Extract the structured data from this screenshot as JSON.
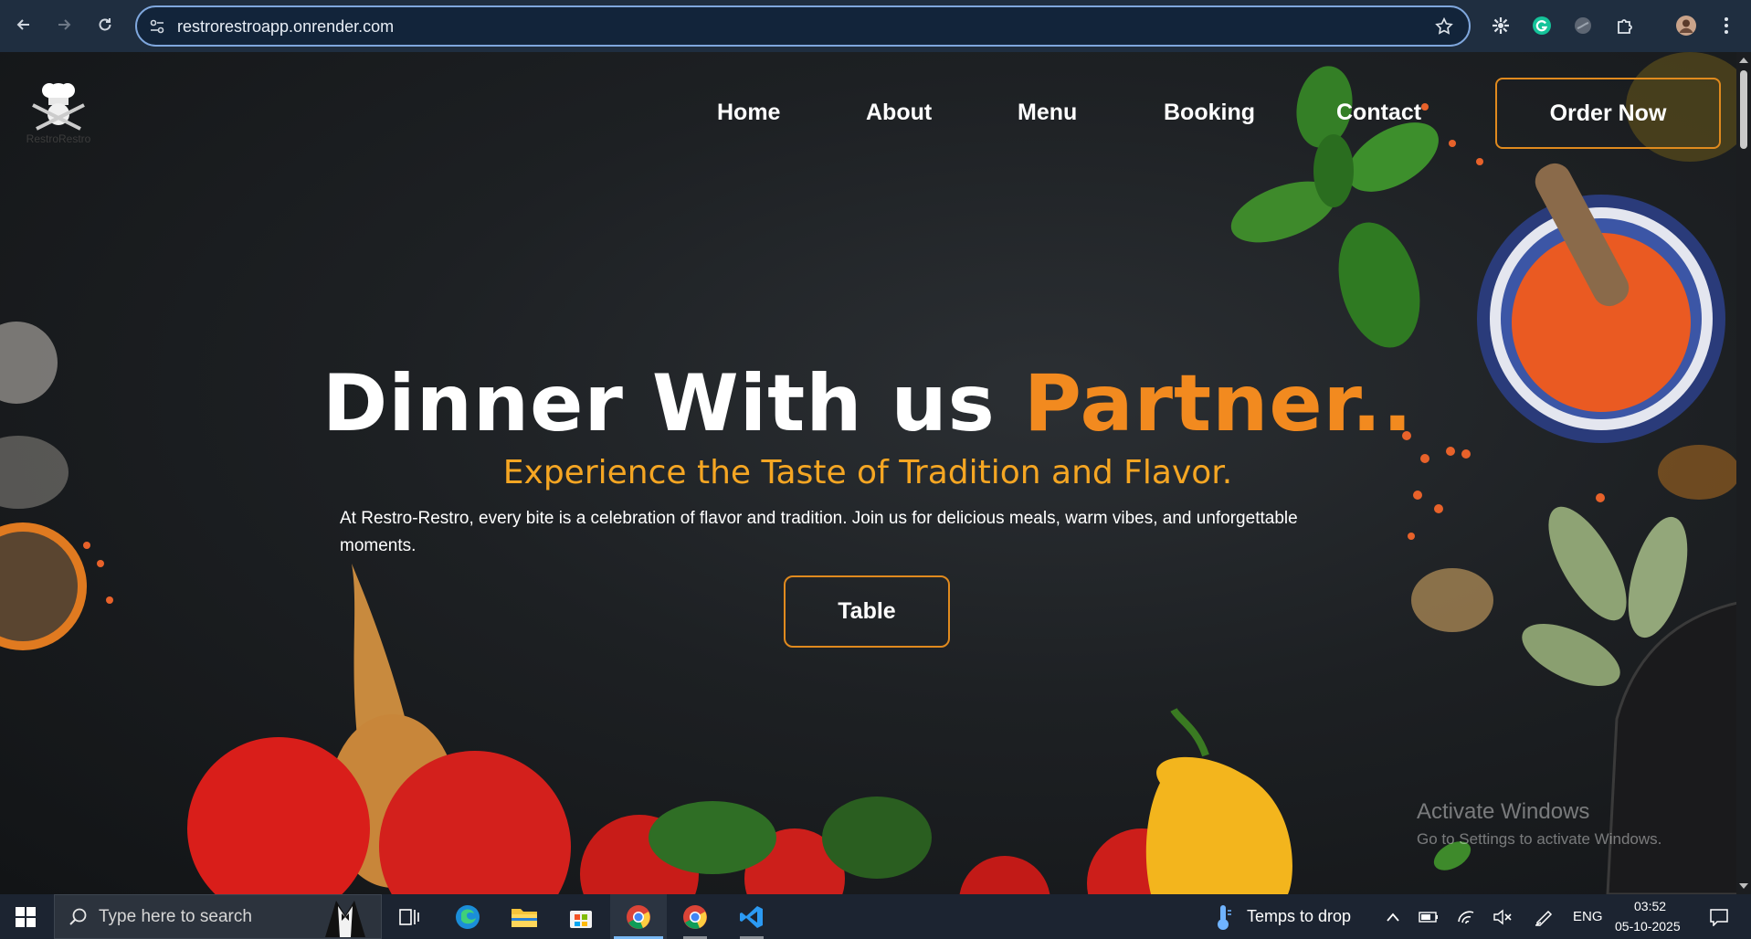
{
  "browser": {
    "url": "restrorestroapp.onrender.com",
    "back_icon": "arrow-left-icon",
    "forward_icon": "arrow-right-icon",
    "reload_icon": "reload-icon",
    "star_icon": "star-icon"
  },
  "site": {
    "logo_text": "RestroRestro",
    "nav": [
      "Home",
      "About",
      "Menu",
      "Booking",
      "Contact"
    ],
    "order_button": "Order Now",
    "hero": {
      "title_main": "Dinner With us ",
      "title_accent": "Partner..",
      "subtitle": "Experience the Taste of Tradition and Flavor.",
      "description": "At Restro-Restro, every bite is a celebration of flavor and tradition. Join us for delicious meals, warm vibes, and unforgettable moments.",
      "button": "Table"
    },
    "colors": {
      "accent": "#f28a1f",
      "subtitle": "#f5a623",
      "button_border": "#e08a1e"
    }
  },
  "watermark": {
    "line1": "Activate Windows",
    "line2": "Go to Settings to activate Windows."
  },
  "taskbar": {
    "search_placeholder": "Type here to search",
    "weather": "Temps to drop",
    "language": "ENG",
    "time": "03:52",
    "date": "05-10-2025"
  }
}
